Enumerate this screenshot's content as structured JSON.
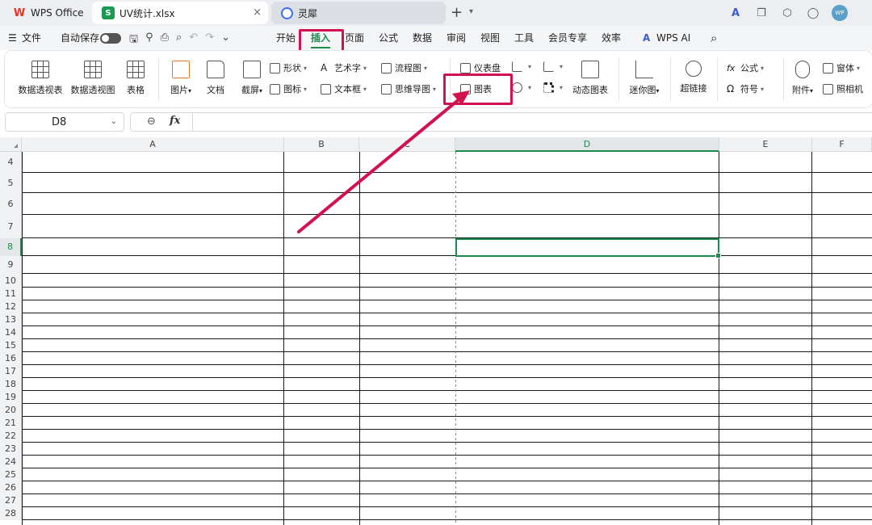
{
  "tabs": {
    "wps": "WPS Office",
    "file": "UV统计.xlsx",
    "ai": "灵犀",
    "file_icon": "S",
    "close": "×",
    "new_tab": "+",
    "avatar": "WP"
  },
  "menubar": {
    "hamburger": "☰",
    "file": "文件",
    "autosave": "自动保存",
    "tabs": [
      "开始",
      "插入",
      "页面",
      "公式",
      "数据",
      "审阅",
      "视图",
      "工具",
      "会员专享",
      "效率"
    ],
    "active_tab": "插入",
    "wps_ai": "WPS AI"
  },
  "ribbon": {
    "pivot_table": "数据透视表",
    "pivot_chart": "数据透视图",
    "table": "表格",
    "picture": "图片",
    "doc": "文档",
    "screenshot": "截屏",
    "shape": "形状",
    "icon": "图标",
    "wordart": "艺术字",
    "textbox": "文本框",
    "flowchart": "流程图",
    "mindmap": "思维导图",
    "dashboard": "仪表盘",
    "chart": "图表",
    "dynamic_chart": "动态图表",
    "sparkline": "迷你图",
    "hyperlink": "超链接",
    "formula": "公式",
    "symbol": "符号",
    "attachment": "附件",
    "window": "窗体",
    "camera": "照相机"
  },
  "formula_bar": {
    "cell_ref": "D8",
    "fx": "fx",
    "content": ""
  },
  "sheet": {
    "columns": [
      "A",
      "B",
      "C",
      "D",
      "E",
      "F"
    ],
    "selected_column": "D",
    "rows": [
      "4",
      "5",
      "6",
      "7",
      "8",
      "9",
      "10",
      "11",
      "12",
      "13",
      "14",
      "15",
      "16",
      "17",
      "18",
      "19",
      "20",
      "21",
      "22",
      "23",
      "24",
      "25",
      "26",
      "27",
      "28"
    ],
    "selected_row": "8"
  },
  "colors": {
    "accent_green": "#1d8a4e",
    "highlight_red": "#d1124f"
  }
}
